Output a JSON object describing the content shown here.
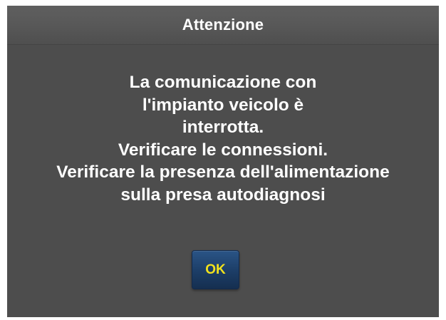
{
  "dialog": {
    "title": "Attenzione",
    "message_lines": [
      "La comunicazione con",
      "l'impianto veicolo è",
      "interrotta.",
      "Verificare le connessioni.",
      "Verificare la presenza dell'alimentazione",
      "sulla presa autodiagnosi"
    ],
    "ok_label": "OK"
  },
  "colors": {
    "dialog_background": "#4d4d4d",
    "title_text": "#ffffff",
    "message_text": "#ffffff",
    "button_background": "#1c3d66",
    "button_label": "#f2e21c"
  }
}
